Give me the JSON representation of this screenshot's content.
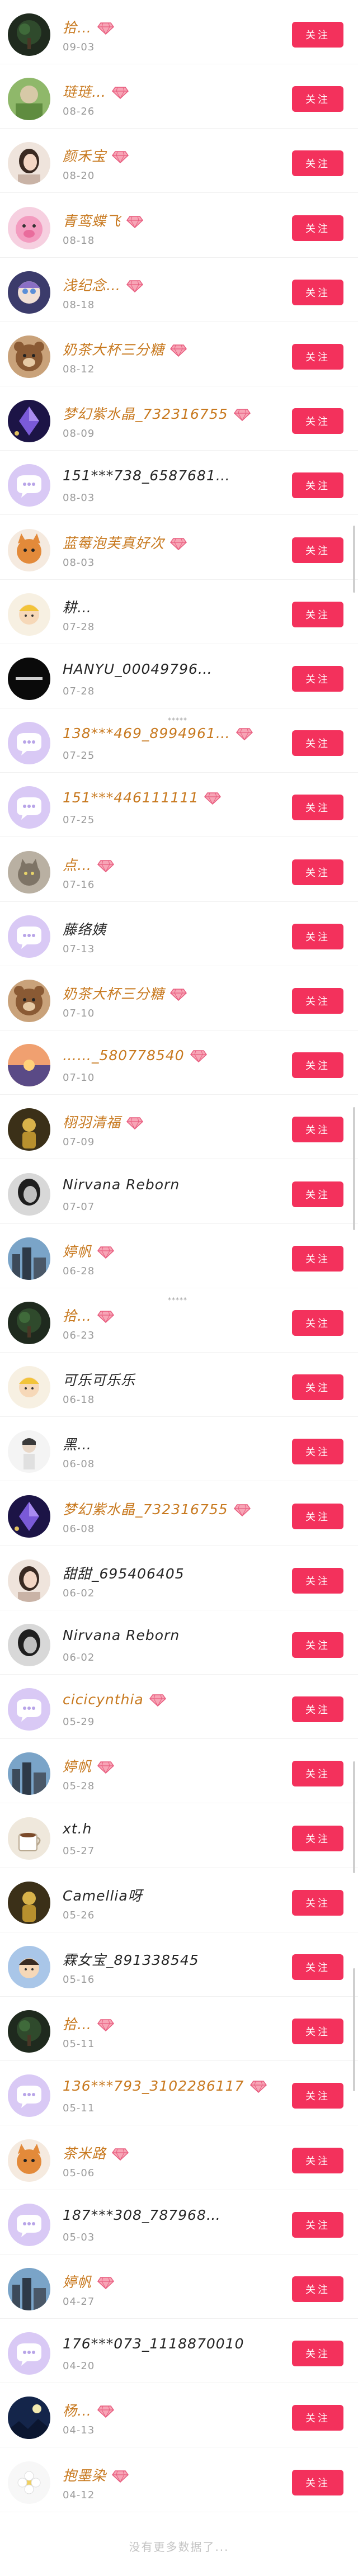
{
  "follow_label": "关注",
  "footer_text": "没有更多数据了...",
  "colors": {
    "follow_button": "#f3315c",
    "vip_name": "#c8791f",
    "plain_name": "#262626",
    "date": "#9a9a9a"
  },
  "users": [
    {
      "name": "拾…",
      "date": "09-03",
      "vip": true,
      "avatar": "dark-tree-avatar"
    },
    {
      "name": "琏琏…",
      "date": "08-26",
      "vip": true,
      "avatar": "green-nature-avatar"
    },
    {
      "name": "颜禾宝",
      "date": "08-20",
      "vip": true,
      "avatar": "girl-portrait-avatar"
    },
    {
      "name": "青鸾蝶飞",
      "date": "08-18",
      "vip": true,
      "avatar": "pink-pig-avatar"
    },
    {
      "name": "浅纪念…",
      "date": "08-18",
      "vip": true,
      "avatar": "doll-avatar"
    },
    {
      "name": "奶茶大杯三分糖",
      "date": "08-12",
      "vip": true,
      "avatar": "bear-avatar"
    },
    {
      "name": "梦幻紫水晶_732316755",
      "date": "08-09",
      "vip": true,
      "avatar": "purple-crystal-avatar"
    },
    {
      "name": "151***738_6587681…",
      "date": "08-03",
      "vip": false,
      "avatar": "default-chat-avatar"
    },
    {
      "name": "蓝莓泡芙真好次",
      "date": "08-03",
      "vip": true,
      "avatar": "cartoon-cat-avatar"
    },
    {
      "name": "耕…",
      "date": "07-28",
      "vip": false,
      "avatar": "cartoon-kid-avatar"
    },
    {
      "name": "HANYU_00049796…",
      "date": "07-28",
      "vip": false,
      "avatar": "black-text-avatar"
    },
    {
      "name": "138***469_8994961…",
      "date": "07-25",
      "vip": true,
      "avatar": "default-chat-avatar",
      "stars": "*****"
    },
    {
      "name": "151***446111111",
      "date": "07-25",
      "vip": true,
      "avatar": "default-chat-avatar"
    },
    {
      "name": "点…",
      "date": "07-16",
      "vip": true,
      "avatar": "gray-cat-avatar"
    },
    {
      "name": "藤络姨",
      "date": "07-13",
      "vip": false,
      "avatar": "default-chat-avatar"
    },
    {
      "name": "奶茶大杯三分糖",
      "date": "07-10",
      "vip": true,
      "avatar": "bear-avatar"
    },
    {
      "name": "……_580778540",
      "date": "07-10",
      "vip": true,
      "avatar": "sunset-avatar"
    },
    {
      "name": "栩羽清福",
      "date": "07-09",
      "vip": true,
      "avatar": "golden-figure-avatar"
    },
    {
      "name": "Nirvana Reborn",
      "date": "07-07",
      "vip": false,
      "avatar": "bw-girl-avatar"
    },
    {
      "name": "婷帆",
      "date": "06-28",
      "vip": true,
      "avatar": "city-avatar"
    },
    {
      "name": "拾…",
      "date": "06-23",
      "vip": true,
      "avatar": "dark-tree-avatar",
      "stars": "*****"
    },
    {
      "name": "可乐可乐乐",
      "date": "06-18",
      "vip": false,
      "avatar": "cartoon-kid-avatar"
    },
    {
      "name": "黑…",
      "date": "06-08",
      "vip": false,
      "avatar": "girl-sketch-avatar"
    },
    {
      "name": "梦幻紫水晶_732316755",
      "date": "06-08",
      "vip": true,
      "avatar": "purple-crystal-avatar"
    },
    {
      "name": "甜甜_695406405",
      "date": "06-02",
      "vip": false,
      "avatar": "girl-portrait-avatar"
    },
    {
      "name": "Nirvana Reborn",
      "date": "06-02",
      "vip": false,
      "avatar": "bw-girl-avatar"
    },
    {
      "name": "cicicynthia",
      "date": "05-29",
      "vip": true,
      "avatar": "default-chat-avatar"
    },
    {
      "name": "婷帆",
      "date": "05-28",
      "vip": true,
      "avatar": "city-avatar"
    },
    {
      "name": "xt.h",
      "date": "05-27",
      "vip": false,
      "avatar": "cup-avatar"
    },
    {
      "name": "Camellia呀",
      "date": "05-26",
      "vip": false,
      "avatar": "golden-figure-avatar"
    },
    {
      "name": "霖女宝_891338545",
      "date": "05-16",
      "vip": false,
      "avatar": "cartoon-boy-avatar"
    },
    {
      "name": "拾…",
      "date": "05-11",
      "vip": true,
      "avatar": "dark-tree-avatar"
    },
    {
      "name": "136***793_3102286117",
      "date": "05-11",
      "vip": true,
      "avatar": "default-chat-avatar"
    },
    {
      "name": "茶米路",
      "date": "05-06",
      "vip": true,
      "avatar": "cartoon-cat-avatar"
    },
    {
      "name": "187***308_787968…",
      "date": "05-03",
      "vip": false,
      "avatar": "default-chat-avatar"
    },
    {
      "name": "婷帆",
      "date": "04-27",
      "vip": true,
      "avatar": "city-avatar"
    },
    {
      "name": "176***073_1118870010",
      "date": "04-20",
      "vip": false,
      "avatar": "default-chat-avatar"
    },
    {
      "name": "杨…",
      "date": "04-13",
      "vip": true,
      "avatar": "night-sky-avatar"
    },
    {
      "name": "抱墨染",
      "date": "04-12",
      "vip": true,
      "avatar": "white-flower-avatar"
    }
  ]
}
